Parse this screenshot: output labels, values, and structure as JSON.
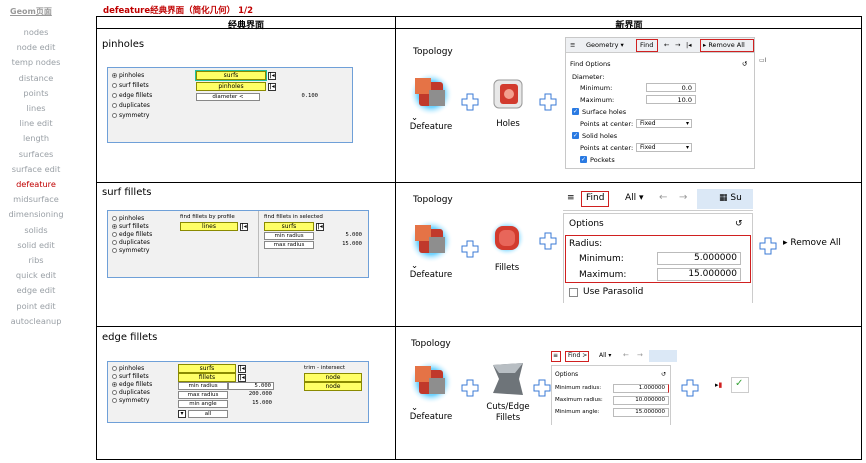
{
  "nav": {
    "title": "Geom页面",
    "items": [
      "nodes",
      "node edit",
      "temp nodes",
      "distance",
      "points",
      "lines",
      "line edit",
      "length",
      "surfaces",
      "surface edit",
      "defeature",
      "midsurface",
      "dimensioning",
      "solids",
      "solid edit",
      "ribs",
      "quick edit",
      "edge edit",
      "point edit",
      "autocleanup"
    ],
    "active": "defeature"
  },
  "doc_title": "defeature经典界面（简化几何） 1/2",
  "columns": {
    "classic": "经典界面",
    "new": "新界面"
  },
  "rows": [
    {
      "label": "pinholes"
    },
    {
      "label": "surf fillets"
    },
    {
      "label": "edge fillets"
    }
  ],
  "classic1": {
    "options": [
      "pinholes",
      "surf fillets",
      "edge fillets",
      "duplicates",
      "symmetry"
    ],
    "selected": "pinholes",
    "surfs": "surfs",
    "pinholes_btn": "pinholes",
    "diameter_label": "diameter <",
    "diameter_value": "0.100"
  },
  "classic2": {
    "options": [
      "pinholes",
      "surf fillets",
      "edge fillets",
      "duplicates",
      "symmetry"
    ],
    "selected": "surf fillets",
    "by_profile": "find fillets by profile",
    "in_selected": "find fillets in selected",
    "lines": "lines",
    "surfs": "surfs",
    "min_radius_label": "min radius",
    "min_radius": "5.000",
    "max_radius_label": "max radius",
    "max_radius": "15.000"
  },
  "classic3": {
    "options": [
      "pinholes",
      "surf fillets",
      "edge fillets",
      "duplicates",
      "symmetry"
    ],
    "selected": "edge fillets",
    "surfs": "surfs",
    "fillets": "fillets",
    "min_radius_label": "min radius",
    "min_radius": "5.000",
    "max_radius_label": "max radius",
    "max_radius": "200.000",
    "min_angle_label": "min angle",
    "min_angle": "15.000",
    "all": "all",
    "trim_intersect": "trim - intersect",
    "node1": "node",
    "node2": "node"
  },
  "new1": {
    "topology": "Topology",
    "defeature": "Defeature",
    "holes": "Holes",
    "toolbar": {
      "geometry": "Geometry",
      "find": "Find",
      "remove_all": "▸ Remove All"
    },
    "find_options": "Find Options",
    "diameter": "Diameter:",
    "minimum": "Minimum:",
    "min_val": "0.0",
    "maximum": "Maximum:",
    "max_val": "10.0",
    "surface_holes": "Surface holes",
    "points_at_center": "Points at center:",
    "fixed": "Fixed",
    "solid_holes": "Solid holes",
    "points_at_center2": "Points at center:",
    "fixed2": "Fixed",
    "pockets": "Pockets"
  },
  "new2": {
    "topology": "Topology",
    "defeature": "Defeature",
    "fillets": "Fillets",
    "find": "Find",
    "all": "All",
    "su": "Su",
    "options": "Options",
    "radius": "Radius:",
    "minimum": "Minimum:",
    "min_val": "5.000000",
    "maximum": "Maximum:",
    "max_val": "15.000000",
    "use_parasolid": "Use Parasolid",
    "remove_all": "Remove All"
  },
  "new3": {
    "topology": "Topology",
    "defeature": "Defeature",
    "cuts": "Cuts/Edge",
    "fillets": "Fillets",
    "find": "Find >",
    "all": "All",
    "options": "Options",
    "min_radius": "Minimum radius:",
    "min_val": "1.000000",
    "max_radius": "Maximum radius:",
    "max_val": "10.000000",
    "min_angle": "Minimum angle:",
    "angle_val": "15.000000"
  }
}
